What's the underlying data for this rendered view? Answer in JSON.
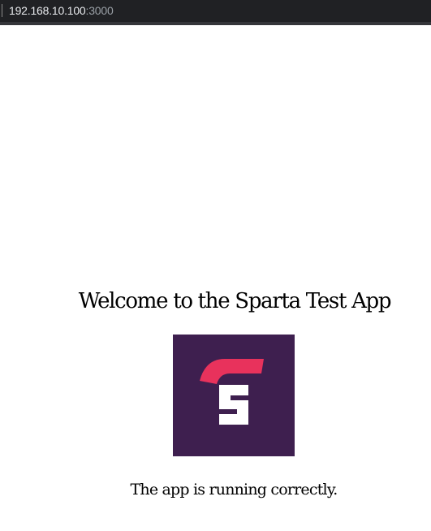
{
  "browser": {
    "url_host": "192.168.10.100",
    "url_port": ":3000"
  },
  "page": {
    "title": "Welcome to the Sparta Test App",
    "status": "The app is running correctly.",
    "logo": {
      "icon": "sparta-s-logo",
      "background_color": "#3e1f4f",
      "accent_color": "#e8325c",
      "letter_color": "#ffffff"
    }
  }
}
